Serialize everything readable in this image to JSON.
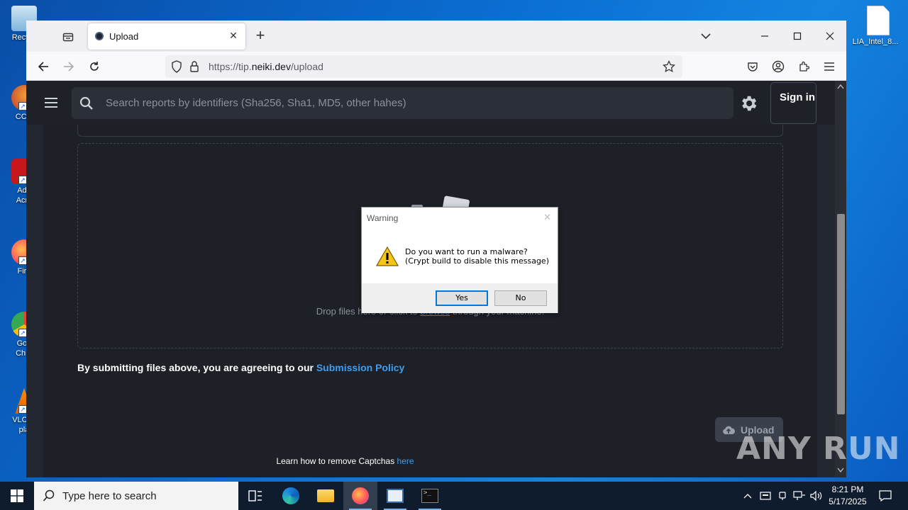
{
  "desktop": {
    "icons": [
      {
        "label": "Recyc"
      },
      {
        "label": "CCle"
      },
      {
        "label": "Ado Acro"
      },
      {
        "label": "Fire"
      },
      {
        "label": "Goo Chro"
      },
      {
        "label": "VLC m pla"
      },
      {
        "label": "LIA_Intel_8..."
      }
    ]
  },
  "browser": {
    "tab": {
      "title": "Upload"
    },
    "url": {
      "prefix": "https://tip.",
      "domain": "neiki.dev",
      "path": "/upload"
    }
  },
  "site": {
    "search_placeholder": "Search reports by identifiers (Sha256, Sha1, MD5, other hahes)",
    "sign_in": "Sign in",
    "drop_text_before": "Drop files here or click to ",
    "drop_link": "browse",
    "drop_text_after": " through your machine.",
    "policy_text": "By submitting files above, you are agreeing to our ",
    "policy_link": "Submission Policy",
    "upload_button": "Upload",
    "captcha_text": "Learn how to remove Captchas ",
    "captcha_link": "here"
  },
  "dialog": {
    "title": "Warning",
    "line1": "Do you want to run a malware?",
    "line2": "(Crypt build to disable this message)",
    "yes": "Yes",
    "no": "No"
  },
  "watermark": "ANY RUN",
  "taskbar": {
    "search_placeholder": "Type here to search",
    "time": "8:21 PM",
    "date": "5/17/2025"
  }
}
